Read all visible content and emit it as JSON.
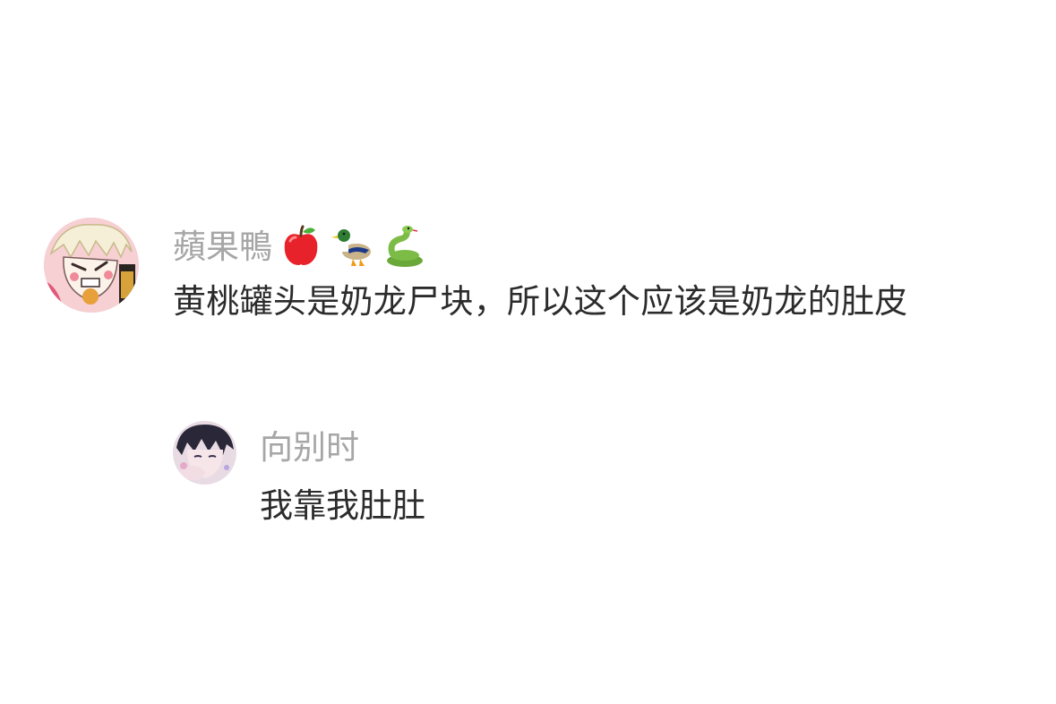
{
  "comments": [
    {
      "username": "蘋果鴨",
      "username_emojis": [
        "apple-emoji",
        "duck-emoji",
        "snake-emoji"
      ],
      "text": "黄桃罐头是奶龙尸块，所以这个应该是奶龙的肚皮",
      "avatar": "anime-avatar-pink"
    },
    {
      "username": "向别时",
      "text": "我靠我肚肚",
      "avatar": "anime-avatar-boy"
    }
  ],
  "colors": {
    "username": "#a6a6a6",
    "text": "#2b2b2b",
    "background": "#ffffff"
  }
}
